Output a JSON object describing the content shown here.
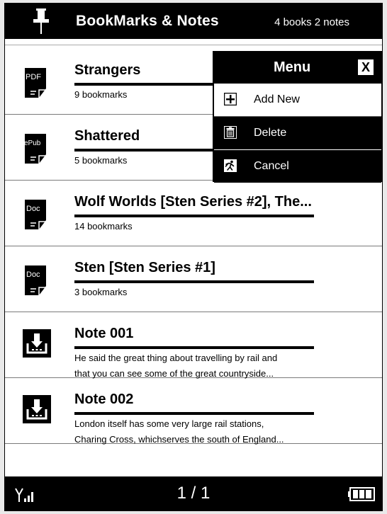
{
  "header": {
    "title": "BookMarks & Notes",
    "count": "4 books 2 notes"
  },
  "items": [
    {
      "type": "pdf",
      "badge": "PDF",
      "title": "Strangers",
      "line1": "9 bookmarks",
      "line2": ""
    },
    {
      "type": "epub",
      "badge": "ePub",
      "title": "Shattered",
      "line1": "5 bookmarks",
      "line2": ""
    },
    {
      "type": "doc",
      "badge": "Doc",
      "title": "Wolf Worlds [Sten Series #2], The...",
      "line1": "14 bookmarks",
      "line2": ""
    },
    {
      "type": "doc",
      "badge": "Doc",
      "title": "Sten [Sten Series #1]",
      "line1": "3 bookmarks",
      "line2": ""
    },
    {
      "type": "note",
      "badge": "",
      "title": "Note 001",
      "line1": "He said the great thing about travelling by rail and",
      "line2": "that you can see some of the great countryside..."
    },
    {
      "type": "note",
      "badge": "",
      "title": "Note 002",
      "line1": "London itself has some very large rail stations,",
      "line2": "Charing Cross, whichserves the south of England..."
    }
  ],
  "menu": {
    "title": "Menu",
    "close": "X",
    "items": [
      {
        "label": "Add New",
        "icon": "plus-icon",
        "selected": false
      },
      {
        "label": "Delete",
        "icon": "trash-icon",
        "selected": true
      },
      {
        "label": "Cancel",
        "icon": "run-icon",
        "selected": true
      }
    ]
  },
  "footer": {
    "page": "1 / 1",
    "signal_icon": "signal-icon",
    "battery_icon": "battery-icon"
  },
  "colors": {
    "background": "#ffffff",
    "chrome": "#000000",
    "divider": "#7a7a7a"
  }
}
